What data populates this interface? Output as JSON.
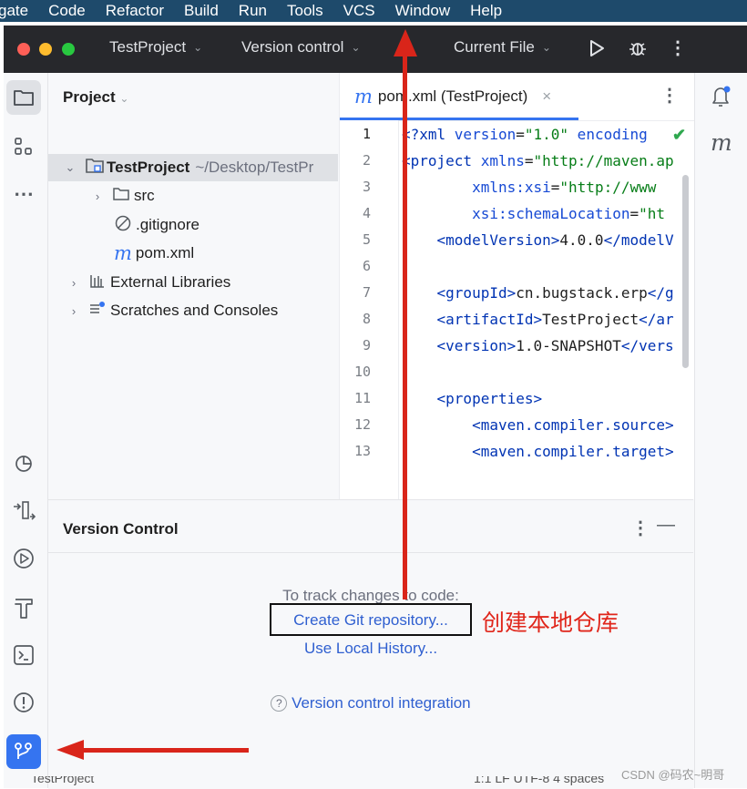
{
  "menubar": {
    "items": [
      "gate",
      "Code",
      "Refactor",
      "Build",
      "Run",
      "Tools",
      "VCS",
      "Window",
      "Help"
    ]
  },
  "titlebar": {
    "project": "TestProject",
    "vcs": "Version control",
    "run_config": "Current File"
  },
  "project_panel": {
    "title": "Project",
    "tree": [
      {
        "label": "TestProject",
        "path": "~/Desktop/TestPr",
        "icon": "folder-module-icon"
      },
      {
        "label": "src",
        "icon": "folder-icon"
      },
      {
        "label": ".gitignore",
        "icon": "ignored-file-icon"
      },
      {
        "label": "pom.xml",
        "icon": "maven-icon"
      },
      {
        "label": "External Libraries",
        "icon": "library-icon"
      },
      {
        "label": "Scratches and Consoles",
        "icon": "scratches-icon"
      }
    ]
  },
  "editor": {
    "tab_label": "pom.xml (TestProject)",
    "line_numbers": [
      "1",
      "2",
      "3",
      "4",
      "5",
      "6",
      "7",
      "8",
      "9",
      "10",
      "11",
      "12",
      "13"
    ],
    "lines": [
      {
        "a": "<?xml ",
        "b": "version",
        "c": "=",
        "d": "\"1.0\"",
        "e": " encoding"
      },
      {
        "a": "<project ",
        "b": "xmlns",
        "c": "=",
        "d": "\"http://maven.ap",
        "e": ""
      },
      {
        "a": "        ",
        "b": "xmlns:xsi",
        "c": "=",
        "d": "\"http://www",
        "e": ""
      },
      {
        "a": "        ",
        "b": "xsi:schemaLocation",
        "c": "=",
        "d": "\"ht",
        "e": ""
      },
      {
        "a": "    <modelVersion>",
        "b": "",
        "c": "4.0.0",
        "d": "",
        "e": "</modelV"
      },
      {
        "a": "",
        "b": "",
        "c": "",
        "d": "",
        "e": ""
      },
      {
        "a": "    <groupId>",
        "b": "",
        "c": "cn.bugstack.erp",
        "d": "",
        "e": "</g"
      },
      {
        "a": "    <artifactId>",
        "b": "",
        "c": "TestProject",
        "d": "",
        "e": "</ar"
      },
      {
        "a": "    <version>",
        "b": "",
        "c": "1.0-SNAPSHOT",
        "d": "",
        "e": "</vers"
      },
      {
        "a": "",
        "b": "",
        "c": "",
        "d": "",
        "e": ""
      },
      {
        "a": "    <properties>",
        "b": "",
        "c": "",
        "d": "",
        "e": ""
      },
      {
        "a": "        <maven.compiler.source>",
        "b": "",
        "c": "",
        "d": "",
        "e": ""
      },
      {
        "a": "        <maven.compiler.target>",
        "b": "",
        "c": "",
        "d": "",
        "e": ""
      }
    ]
  },
  "version_control": {
    "title": "Version Control",
    "hint": "To track changes to code:",
    "create_repo": "Create Git repository...",
    "local_history": "Use Local History...",
    "integration": "Version control integration"
  },
  "annotation": {
    "label": "创建本地仓库",
    "color": "#e0261b"
  },
  "watermark": "CSDN @码农~明哥",
  "status": {
    "left": "TestProject",
    "right": "1:1   LF   UTF-8   4 spaces"
  },
  "colors": {
    "accent": "#3574f0",
    "titlebar": "#27282c",
    "menubar": "#1e4a6b",
    "annotation": "#d9251a"
  }
}
